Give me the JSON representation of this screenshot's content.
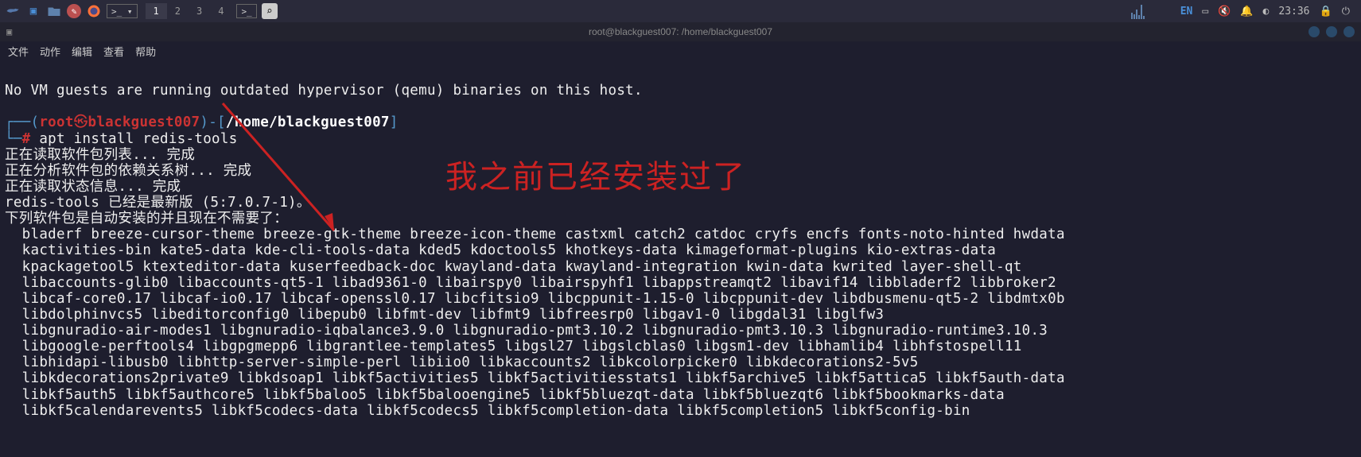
{
  "taskbar": {
    "workspaces": [
      "1",
      "2",
      "3",
      "4"
    ],
    "active_workspace": 0,
    "lang": "EN",
    "time": "23:36"
  },
  "window": {
    "title": "root@blackguest007: /home/blackguest007"
  },
  "menu": {
    "items": [
      "文件",
      "动作",
      "编辑",
      "查看",
      "帮助"
    ]
  },
  "terminal": {
    "line_novm": "No VM guests are running outdated hypervisor (qemu) binaries on this host.",
    "user": "root",
    "at": "㉿",
    "host": "blackguest007",
    "path": "/home/blackguest007",
    "cmd": "apt install redis-tools",
    "out1": "正在读取软件包列表... 完成",
    "out2": "正在分析软件包的依赖关系树... 完成",
    "out3": "正在读取状态信息... 完成",
    "out4": "redis-tools 已经是最新版 (5:7.0.7-1)。",
    "out5": "下列软件包是自动安装的并且现在不需要了：",
    "pkg1": "  bladerf breeze-cursor-theme breeze-gtk-theme breeze-icon-theme castxml catch2 catdoc cryfs encfs fonts-noto-hinted hwdata",
    "pkg2": "  kactivities-bin kate5-data kde-cli-tools-data kded5 kdoctools5 khotkeys-data kimageformat-plugins kio-extras-data",
    "pkg3": "  kpackagetool5 ktexteditor-data kuserfeedback-doc kwayland-data kwayland-integration kwin-data kwrited layer-shell-qt",
    "pkg4": "  libaccounts-glib0 libaccounts-qt5-1 libad9361-0 libairspy0 libairspyhf1 libappstreamqt2 libavif14 libbladerf2 libbroker2",
    "pkg5": "  libcaf-core0.17 libcaf-io0.17 libcaf-openssl0.17 libcfitsio9 libcppunit-1.15-0 libcppunit-dev libdbusmenu-qt5-2 libdmtx0b",
    "pkg6": "  libdolphinvcs5 libeditorconfig0 libepub0 libfmt-dev libfmt9 libfreesrp0 libgav1-0 libgdal31 libglfw3",
    "pkg7": "  libgnuradio-air-modes1 libgnuradio-iqbalance3.9.0 libgnuradio-pmt3.10.2 libgnuradio-pmt3.10.3 libgnuradio-runtime3.10.3",
    "pkg8": "  libgoogle-perftools4 libgpgmepp6 libgrantlee-templates5 libgsl27 libgslcblas0 libgsm1-dev libhamlib4 libhfstospell11",
    "pkg9": "  libhidapi-libusb0 libhttp-server-simple-perl libiio0 libkaccounts2 libkcolorpicker0 libkdecorations2-5v5",
    "pkg10": "  libkdecorations2private9 libkdsoap1 libkf5activities5 libkf5activitiesstats1 libkf5archive5 libkf5attica5 libkf5auth-data",
    "pkg11": "  libkf5auth5 libkf5authcore5 libkf5baloo5 libkf5balooengine5 libkf5bluezqt-data libkf5bluezqt6 libkf5bookmarks-data",
    "pkg12": "  libkf5calendarevents5 libkf5codecs-data libkf5codecs5 libkf5completion-data libkf5completion5 libkf5config-bin"
  },
  "annotation": {
    "text": "我之前已经安装过了"
  }
}
